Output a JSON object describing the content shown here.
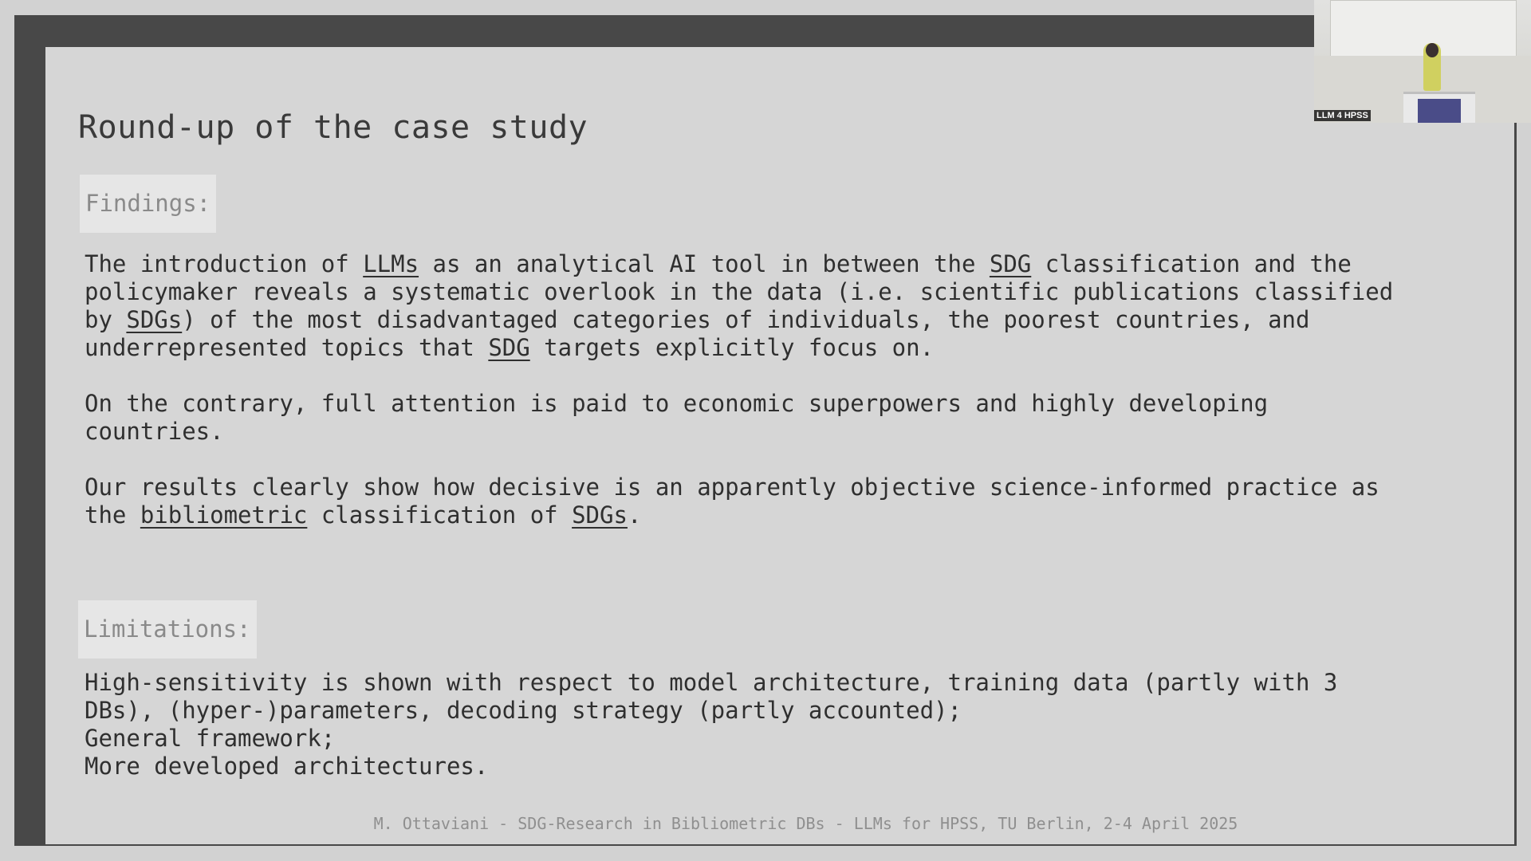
{
  "slide": {
    "title": "Round-up of the case study",
    "findings_label": "Findings:",
    "limitations_label": "Limitations:",
    "findings": [
      {
        "segments": [
          {
            "text": "The introduction of "
          },
          {
            "text": "LLMs",
            "underline": true
          },
          {
            "text": " as an analytical AI tool in between the "
          },
          {
            "text": "SDG",
            "underline": true
          },
          {
            "text": " classification and the\npolicymaker reveals a systematic overlook in the data (i.e. scientific publications classified\nby "
          },
          {
            "text": "SDGs",
            "underline": true
          },
          {
            "text": ") of the most disadvantaged categories of individuals, the poorest countries, and\nunderrepresented topics that "
          },
          {
            "text": "SDG",
            "underline": true
          },
          {
            "text": " targets explicitly focus on."
          }
        ]
      },
      {
        "segments": [
          {
            "text": "On the contrary, full attention is paid to economic superpowers and highly developing\ncountries."
          }
        ]
      },
      {
        "segments": [
          {
            "text": "Our results clearly show how decisive is an apparently objective science-informed practice as\nthe "
          },
          {
            "text": "bibliometric",
            "underline": true
          },
          {
            "text": " classification of "
          },
          {
            "text": "SDGs",
            "underline": true
          },
          {
            "text": "."
          }
        ]
      }
    ],
    "limitations_text": "High-sensitivity is shown with respect to model architecture, training data (partly with 3\nDBs), (hyper-)parameters, decoding strategy (partly accounted);\nGeneral framework;\nMore developed architectures.",
    "footer": "M. Ottaviani - SDG-Research in Bibliometric DBs - LLMs for HPSS, TU Berlin, 2-4 April 2025"
  },
  "video_overlay": {
    "label": "LLM 4 HPSS"
  }
}
